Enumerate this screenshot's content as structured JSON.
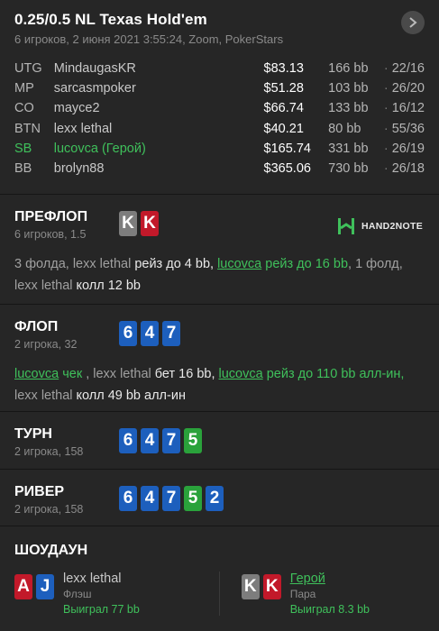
{
  "header": {
    "title": "0.25/0.5 NL Texas Hold'em",
    "subtitle": "6 игроков, 2 июня 2021 3:55:24, Zoom, PokerStars"
  },
  "players": [
    {
      "pos": "UTG",
      "name": "MindaugasKR",
      "stack": "$83.13",
      "bb": "166 bb",
      "stat": "22/16"
    },
    {
      "pos": "MP",
      "name": "sarcasmpoker",
      "stack": "$51.28",
      "bb": "103 bb",
      "stat": "26/20"
    },
    {
      "pos": "CO",
      "name": "mayce2",
      "stack": "$66.74",
      "bb": "133 bb",
      "stat": "16/12"
    },
    {
      "pos": "BTN",
      "name": "lexx lethal",
      "stack": "$40.21",
      "bb": "80 bb",
      "stat": "55/36"
    },
    {
      "pos": "SB",
      "name": "lucovca (Герой)",
      "stack": "$165.74",
      "bb": "331 bb",
      "stat": "26/19"
    },
    {
      "pos": "BB",
      "name": "brolyn88",
      "stack": "$365.06",
      "bb": "730 bb",
      "stat": "26/18"
    }
  ],
  "separator": "·",
  "logo_text": "HAND2NOTE",
  "preflop": {
    "title": "ПРЕФЛОП",
    "sub": "6 игроков, 1.5",
    "cards": [
      "K",
      "K"
    ],
    "actions": [
      "3 фолда, ",
      "lexx lethal",
      " рейз до 4 bb, ",
      "lucovca",
      " рейз до 16 bb",
      ", 1 фолд, ",
      "lexx lethal",
      " колл 12 bb"
    ]
  },
  "flop": {
    "title": "ФЛОП",
    "sub": "2 игрока, 32",
    "cards": [
      "6",
      "4",
      "7"
    ],
    "actions": [
      "lucovca",
      " чек",
      " , ",
      "lexx lethal",
      " бет 16 bb, ",
      "lucovca",
      " рейз до 110 bb алл-ин,",
      "lexx lethal",
      " колл 49 bb алл-ин"
    ]
  },
  "turn": {
    "title": "ТУРН",
    "sub": "2 игрока, 158",
    "cards": [
      "6",
      "4",
      "7",
      "5"
    ]
  },
  "river": {
    "title": "РИВЕР",
    "sub": "2 игрока, 158",
    "cards": [
      "6",
      "4",
      "7",
      "5",
      "2"
    ]
  },
  "showdown": {
    "title": "ШОУДАУН",
    "villain": {
      "cards": [
        "A",
        "J"
      ],
      "name": "lexx lethal",
      "desc": "Флэш",
      "result": "Выиграл 77 bb"
    },
    "hero": {
      "cards": [
        "K",
        "K"
      ],
      "name": "Герой",
      "desc": "Пара",
      "result": "Выиграл 8.3 bb"
    }
  },
  "colors": {
    "hero": "#3fc05b",
    "red_card": "#c2192a",
    "blue_card": "#1d5fbd",
    "green_card": "#2aa23b",
    "gray_card": "#7d7d7d"
  }
}
